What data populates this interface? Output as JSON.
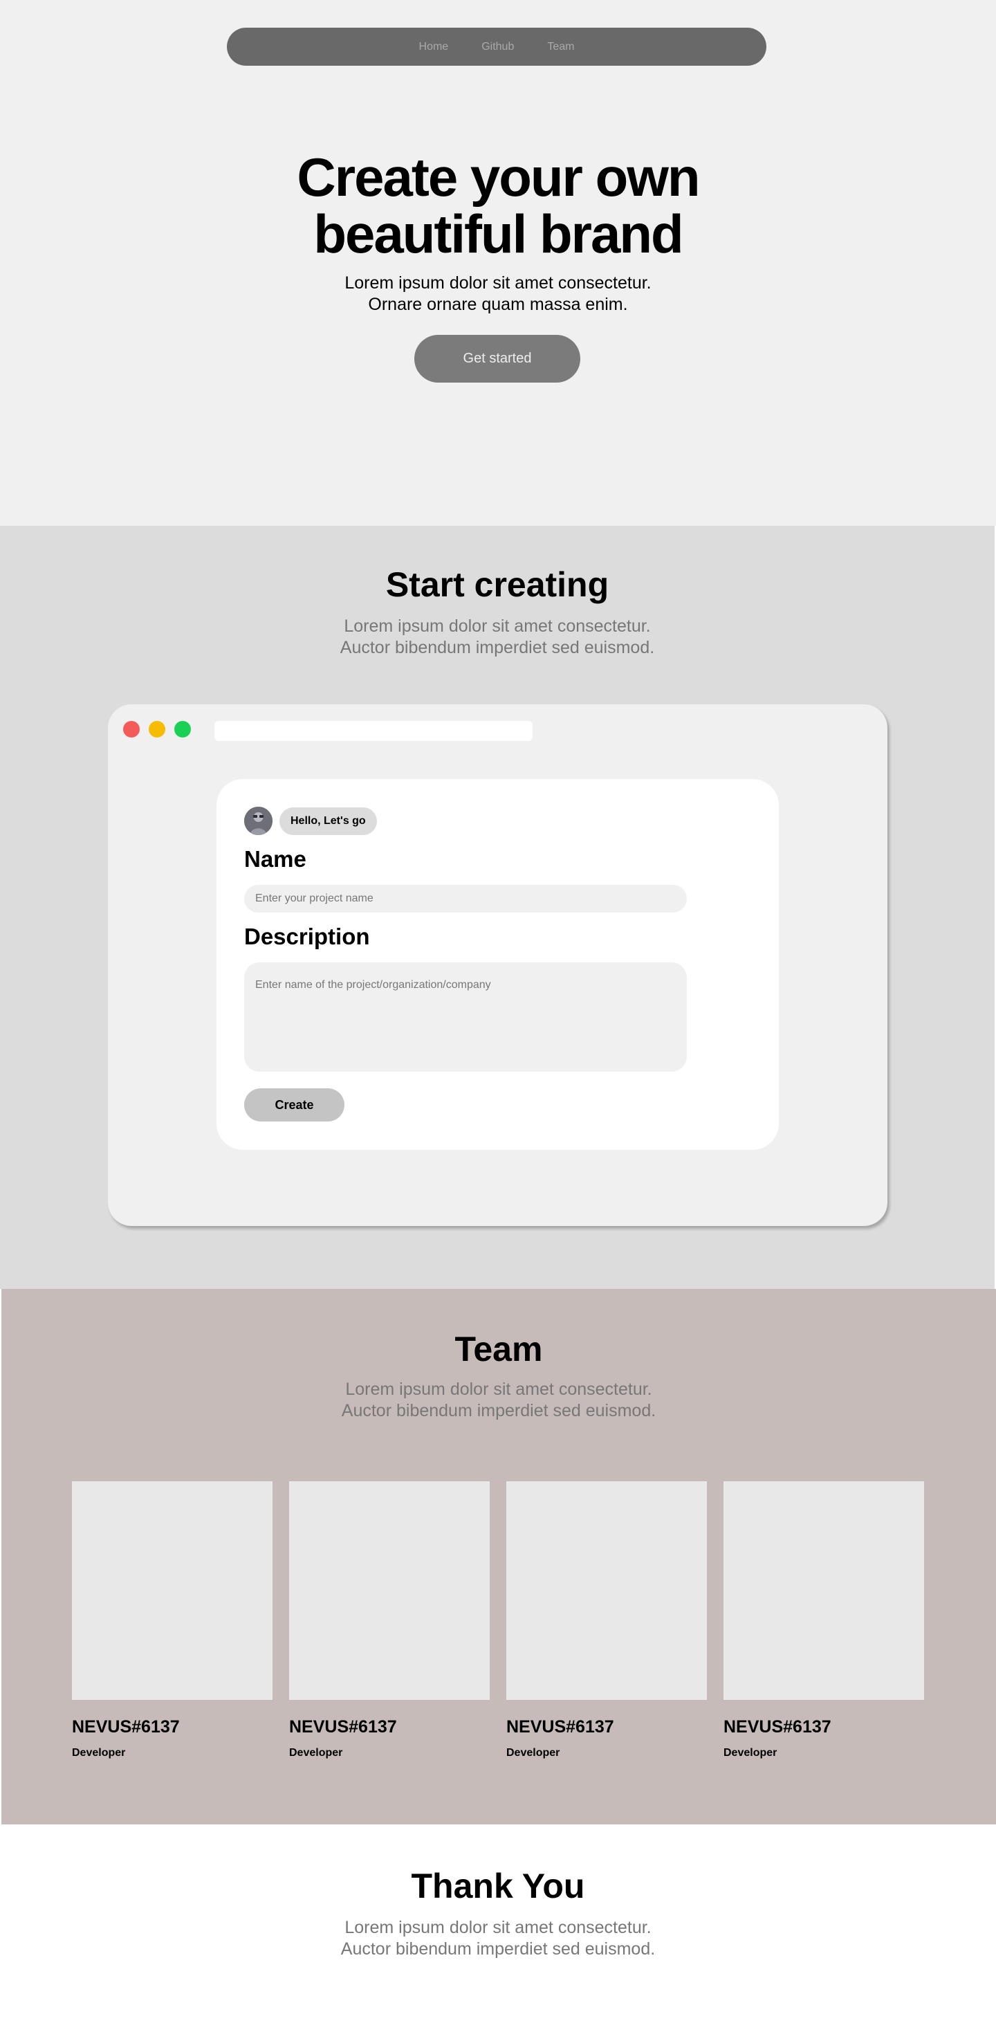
{
  "nav": {
    "items": [
      "Home",
      "Github",
      "Team"
    ]
  },
  "hero": {
    "title_line1": "Create your own",
    "title_line2": "beautiful brand",
    "subtitle_line1": "Lorem ipsum dolor sit amet consectetur.",
    "subtitle_line2": "Ornare ornare quam massa enim.",
    "cta_label": "Get started"
  },
  "creating": {
    "title": "Start creating",
    "subtitle_line1": "Lorem ipsum dolor sit amet consectetur.",
    "subtitle_line2": "Auctor bibendum imperdiet sed euismod.",
    "window": {
      "greeting": "Hello, Let's go",
      "name_label": "Name",
      "name_placeholder": "Enter your project name",
      "description_label": "Description",
      "description_placeholder": "Enter name of the project/organization/company",
      "create_label": "Create"
    }
  },
  "team": {
    "title": "Team",
    "subtitle_line1": "Lorem ipsum dolor sit amet consectetur.",
    "subtitle_line2": "Auctor bibendum imperdiet sed euismod.",
    "members": [
      {
        "name": "NEVUS#6137",
        "role": "Developer"
      },
      {
        "name": "NEVUS#6137",
        "role": "Developer"
      },
      {
        "name": "NEVUS#6137",
        "role": "Developer"
      },
      {
        "name": "NEVUS#6137",
        "role": "Developer"
      }
    ]
  },
  "thanks": {
    "title": "Thank You",
    "subtitle_line1": "Lorem ipsum dolor sit amet consectetur.",
    "subtitle_line2": "Auctor bibendum imperdiet sed euismod."
  },
  "colors": {
    "nav_bg": "#696969",
    "cta_bg": "#7b7b7b",
    "hero_bg": "#f0f0f0",
    "creating_bg": "#dcdcdc",
    "team_bg": "#c7bbba",
    "traffic_red": "#f45a57",
    "traffic_yellow": "#f6bd00",
    "traffic_green": "#1bd153"
  }
}
